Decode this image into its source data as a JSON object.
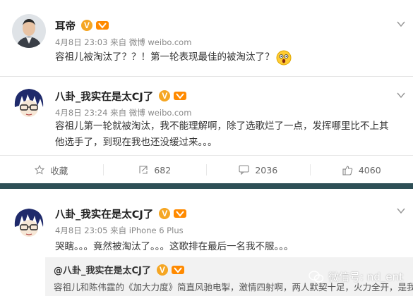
{
  "posts": [
    {
      "username": "耳帝",
      "verified_badge": "V",
      "meta": "4月8日 23:03 来自 微博 weibo.com",
      "text": "容祖儿被淘汰了？？！第一轮表现最佳的被淘汰了？",
      "emoji": "surprised-face"
    },
    {
      "username": "八卦_我实在是太CJ了",
      "verified_badge": "V",
      "meta": "4月8日 23:24 来自 微博 weibo.com",
      "text": "容祖儿第一轮就被淘汰，我不能理解啊，除了选歌烂了一点，发挥哪里比不上其他选手了，到现在我也还没缓过来。。。",
      "actions": {
        "favorite": "收藏",
        "repost": "682",
        "comment": "2036",
        "like": "4060"
      }
    },
    {
      "username": "八卦_我实在是太CJ了",
      "verified_badge": "V",
      "meta": "4月8日 23:05 来自 iPhone 6 Plus",
      "text": "哭瞎。。。竟然被淘汰了。。。这歌排在最后一名我不服。。。",
      "repost": {
        "username": "@八卦_我实在是太CJ了",
        "text": "容祖儿和陈伟霆的《加大力度》简直风驰电掣，激情四射啊，两人默契十足，火力全开，是我"
      }
    }
  ],
  "watermark": "微信号: nd_ent",
  "colors": {
    "badge": "#f5a623",
    "divider_bar": "#2e4f56"
  }
}
